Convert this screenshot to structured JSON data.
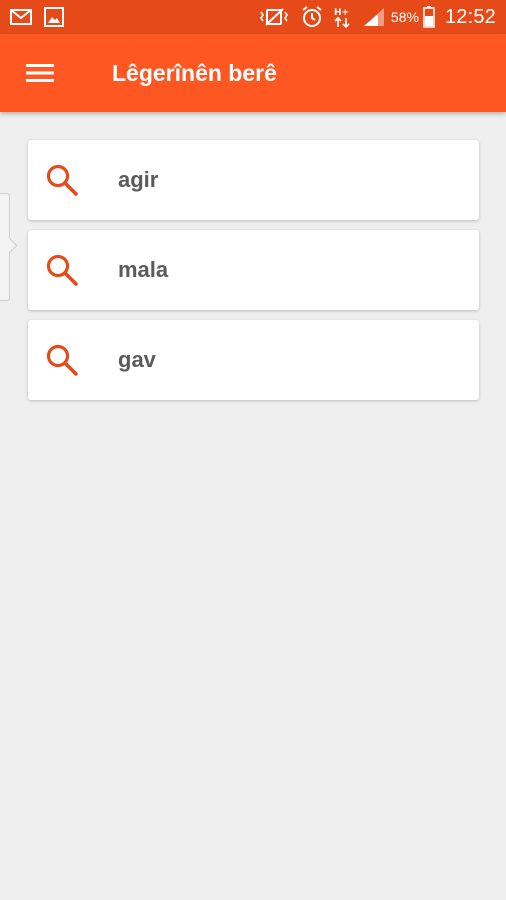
{
  "status_bar": {
    "battery": "58%",
    "time": "12:52",
    "icons": [
      "mail-icon",
      "image-icon",
      "vibrate-icon",
      "alarm-icon",
      "data-arrows-icon",
      "signal-icon",
      "battery-icon"
    ]
  },
  "app_bar": {
    "title": "Lêgerînên berê",
    "menu_icon": "hamburger-menu-icon"
  },
  "history": {
    "items": [
      {
        "word": "agir",
        "icon": "search-icon"
      },
      {
        "word": "mala",
        "icon": "search-icon"
      },
      {
        "word": "gav",
        "icon": "search-icon"
      }
    ]
  },
  "colors": {
    "status_bar": "#e64a19",
    "app_bar": "#ff5722",
    "accent_icon": "#e64a19",
    "background": "#efefef",
    "card": "#ffffff",
    "word_text": "#5b5b5b"
  }
}
